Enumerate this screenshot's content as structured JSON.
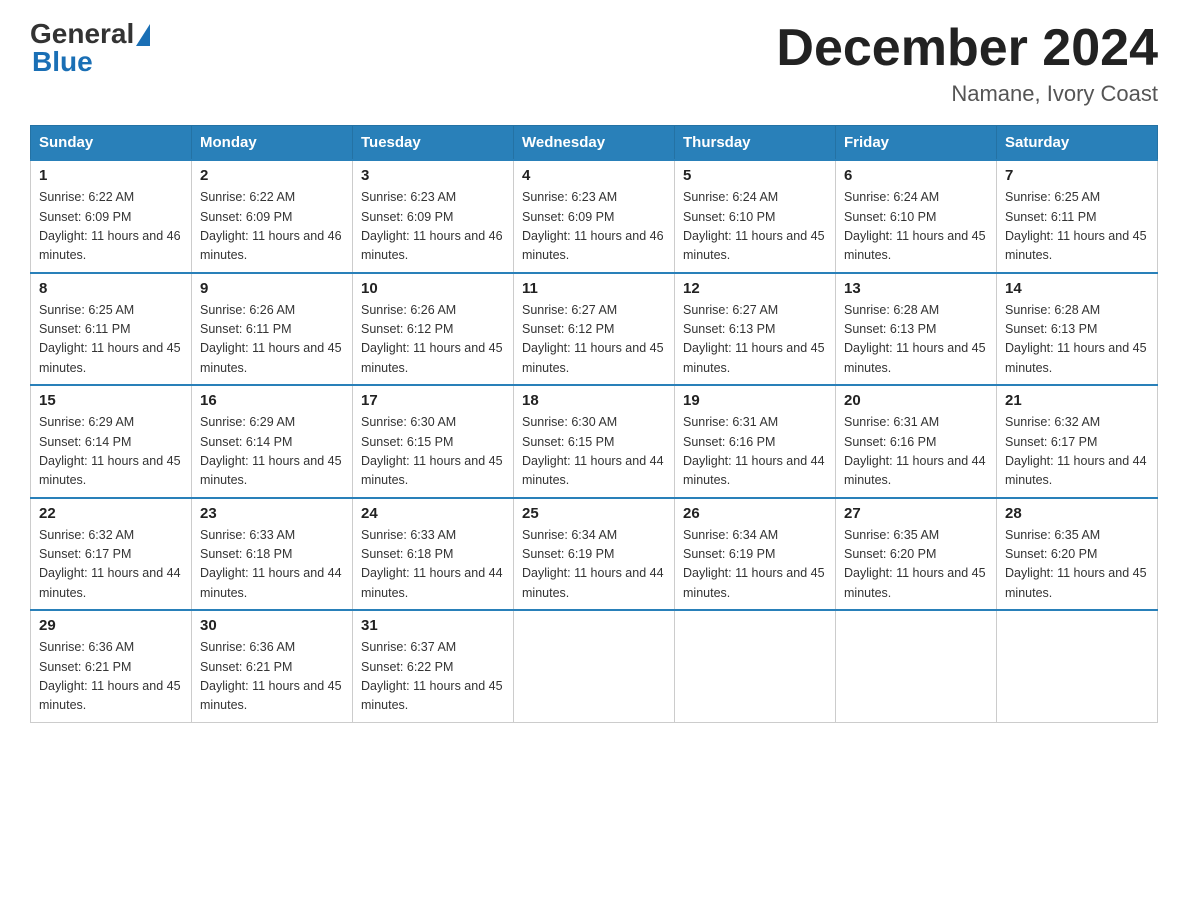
{
  "header": {
    "logo_general": "General",
    "logo_blue": "Blue",
    "month_title": "December 2024",
    "location": "Namane, Ivory Coast"
  },
  "days_of_week": [
    "Sunday",
    "Monday",
    "Tuesday",
    "Wednesday",
    "Thursday",
    "Friday",
    "Saturday"
  ],
  "weeks": [
    [
      {
        "num": "1",
        "sunrise": "6:22 AM",
        "sunset": "6:09 PM",
        "daylight": "11 hours and 46 minutes."
      },
      {
        "num": "2",
        "sunrise": "6:22 AM",
        "sunset": "6:09 PM",
        "daylight": "11 hours and 46 minutes."
      },
      {
        "num": "3",
        "sunrise": "6:23 AM",
        "sunset": "6:09 PM",
        "daylight": "11 hours and 46 minutes."
      },
      {
        "num": "4",
        "sunrise": "6:23 AM",
        "sunset": "6:09 PM",
        "daylight": "11 hours and 46 minutes."
      },
      {
        "num": "5",
        "sunrise": "6:24 AM",
        "sunset": "6:10 PM",
        "daylight": "11 hours and 45 minutes."
      },
      {
        "num": "6",
        "sunrise": "6:24 AM",
        "sunset": "6:10 PM",
        "daylight": "11 hours and 45 minutes."
      },
      {
        "num": "7",
        "sunrise": "6:25 AM",
        "sunset": "6:11 PM",
        "daylight": "11 hours and 45 minutes."
      }
    ],
    [
      {
        "num": "8",
        "sunrise": "6:25 AM",
        "sunset": "6:11 PM",
        "daylight": "11 hours and 45 minutes."
      },
      {
        "num": "9",
        "sunrise": "6:26 AM",
        "sunset": "6:11 PM",
        "daylight": "11 hours and 45 minutes."
      },
      {
        "num": "10",
        "sunrise": "6:26 AM",
        "sunset": "6:12 PM",
        "daylight": "11 hours and 45 minutes."
      },
      {
        "num": "11",
        "sunrise": "6:27 AM",
        "sunset": "6:12 PM",
        "daylight": "11 hours and 45 minutes."
      },
      {
        "num": "12",
        "sunrise": "6:27 AM",
        "sunset": "6:13 PM",
        "daylight": "11 hours and 45 minutes."
      },
      {
        "num": "13",
        "sunrise": "6:28 AM",
        "sunset": "6:13 PM",
        "daylight": "11 hours and 45 minutes."
      },
      {
        "num": "14",
        "sunrise": "6:28 AM",
        "sunset": "6:13 PM",
        "daylight": "11 hours and 45 minutes."
      }
    ],
    [
      {
        "num": "15",
        "sunrise": "6:29 AM",
        "sunset": "6:14 PM",
        "daylight": "11 hours and 45 minutes."
      },
      {
        "num": "16",
        "sunrise": "6:29 AM",
        "sunset": "6:14 PM",
        "daylight": "11 hours and 45 minutes."
      },
      {
        "num": "17",
        "sunrise": "6:30 AM",
        "sunset": "6:15 PM",
        "daylight": "11 hours and 45 minutes."
      },
      {
        "num": "18",
        "sunrise": "6:30 AM",
        "sunset": "6:15 PM",
        "daylight": "11 hours and 44 minutes."
      },
      {
        "num": "19",
        "sunrise": "6:31 AM",
        "sunset": "6:16 PM",
        "daylight": "11 hours and 44 minutes."
      },
      {
        "num": "20",
        "sunrise": "6:31 AM",
        "sunset": "6:16 PM",
        "daylight": "11 hours and 44 minutes."
      },
      {
        "num": "21",
        "sunrise": "6:32 AM",
        "sunset": "6:17 PM",
        "daylight": "11 hours and 44 minutes."
      }
    ],
    [
      {
        "num": "22",
        "sunrise": "6:32 AM",
        "sunset": "6:17 PM",
        "daylight": "11 hours and 44 minutes."
      },
      {
        "num": "23",
        "sunrise": "6:33 AM",
        "sunset": "6:18 PM",
        "daylight": "11 hours and 44 minutes."
      },
      {
        "num": "24",
        "sunrise": "6:33 AM",
        "sunset": "6:18 PM",
        "daylight": "11 hours and 44 minutes."
      },
      {
        "num": "25",
        "sunrise": "6:34 AM",
        "sunset": "6:19 PM",
        "daylight": "11 hours and 44 minutes."
      },
      {
        "num": "26",
        "sunrise": "6:34 AM",
        "sunset": "6:19 PM",
        "daylight": "11 hours and 45 minutes."
      },
      {
        "num": "27",
        "sunrise": "6:35 AM",
        "sunset": "6:20 PM",
        "daylight": "11 hours and 45 minutes."
      },
      {
        "num": "28",
        "sunrise": "6:35 AM",
        "sunset": "6:20 PM",
        "daylight": "11 hours and 45 minutes."
      }
    ],
    [
      {
        "num": "29",
        "sunrise": "6:36 AM",
        "sunset": "6:21 PM",
        "daylight": "11 hours and 45 minutes."
      },
      {
        "num": "30",
        "sunrise": "6:36 AM",
        "sunset": "6:21 PM",
        "daylight": "11 hours and 45 minutes."
      },
      {
        "num": "31",
        "sunrise": "6:37 AM",
        "sunset": "6:22 PM",
        "daylight": "11 hours and 45 minutes."
      },
      null,
      null,
      null,
      null
    ]
  ]
}
